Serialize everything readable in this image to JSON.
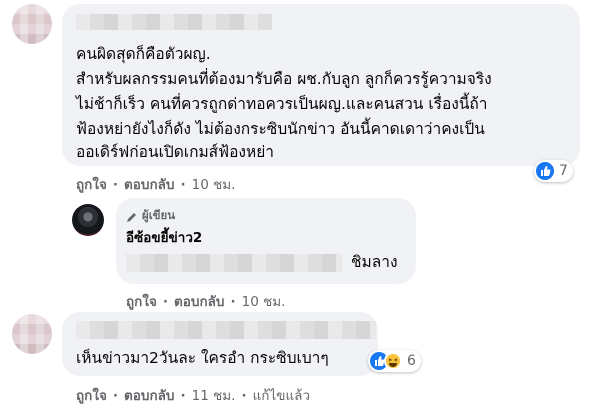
{
  "comments": [
    {
      "lines": [
        "คนผิดสุดก็คือตัวผญ.",
        "สำหรับผลกรรมคนที่ต้องมารับคือ ผช.กับลูก ลูกก็ควรรู้ความจริง",
        "ไม่ช้าก็เร็ว คนที่ควรถูกด่าทอควรเป็นผญ.และคนสวน เรื่องนี้ถ้า",
        "ฟ้องหย่ายังไงก็ดัง ไม่ต้องกระซิบนักข่าว อันนี้คาดเดาว่าคงเป็น",
        "ออเดิร์ฟก่อนเปิดเกมส์ฟ้องหย่า"
      ],
      "like_label": "ถูกใจ",
      "reply_label": "ตอบกลับ",
      "time": "10 ชม.",
      "reaction_count": "7",
      "reaction_icon": "like-icon"
    },
    {
      "badge": "ผู้เขียน",
      "name": "อีซ้อขยี้ข่าว2",
      "text_suffix": "ชิมลาง",
      "like_label": "ถูกใจ",
      "reply_label": "ตอบกลับ",
      "time": "10 ชม."
    },
    {
      "text": "เห็นข่าวมา2วันละ ใครอำ กระซิบเบาๆ",
      "like_label": "ถูกใจ",
      "reply_label": "ตอบกลับ",
      "time": "11 ชม.",
      "edited_label": "แก้ไขแล้ว",
      "reaction_count": "6",
      "reaction_icons": [
        "like-icon",
        "haha-icon"
      ]
    }
  ],
  "colors": {
    "bubble": "#f0f2f5",
    "secondary_text": "#65676b",
    "like_blue": "#1877f2",
    "haha_yellow": "#f7c23b"
  }
}
